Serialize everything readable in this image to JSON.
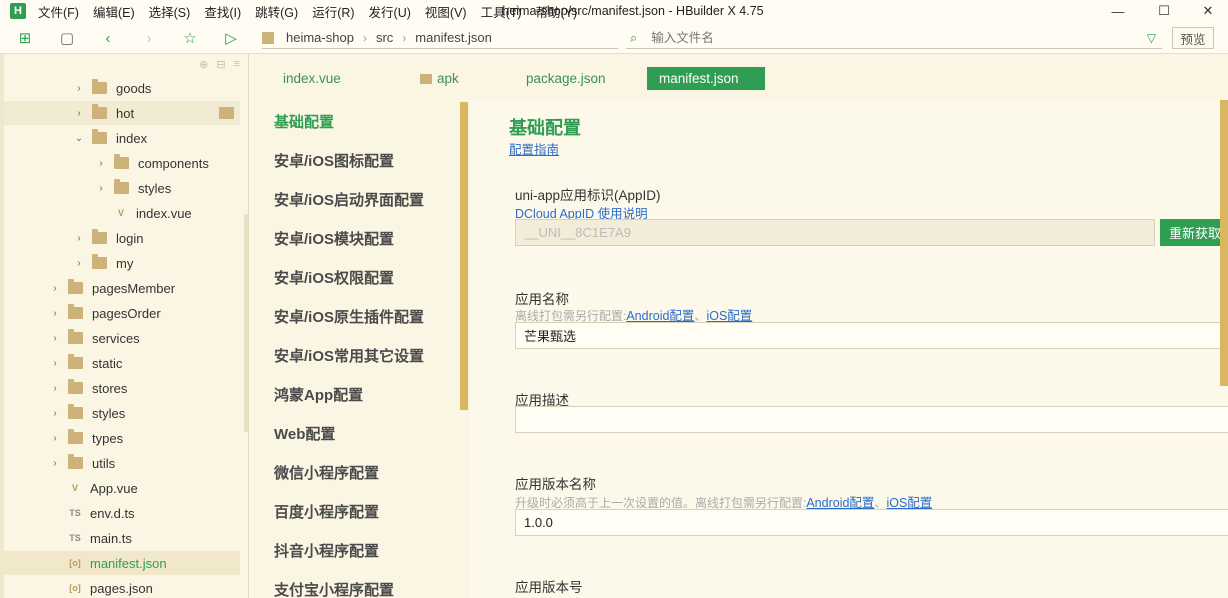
{
  "menubar": {
    "logo": "H",
    "items": [
      "文件(F)",
      "编辑(E)",
      "选择(S)",
      "查找(I)",
      "跳转(G)",
      "运行(R)",
      "发行(U)",
      "视图(V)",
      "工具(T)",
      "帮助(Y)"
    ],
    "title": "heima-shop/src/manifest.json - HBuilder X 4.75"
  },
  "toolbar": {
    "breadcrumb": [
      "heima-shop",
      "src",
      "manifest.json"
    ],
    "search_placeholder": "输入文件名",
    "preview_label": "预览"
  },
  "tree": [
    {
      "label": "goods",
      "type": "folder",
      "depth": 3,
      "expanded": false
    },
    {
      "label": "hot",
      "type": "folder",
      "depth": 3,
      "expanded": false
    },
    {
      "label": "index",
      "type": "folder",
      "depth": 3,
      "expanded": true
    },
    {
      "label": "components",
      "type": "folder",
      "depth": 4,
      "expanded": false
    },
    {
      "label": "styles",
      "type": "folder",
      "depth": 4,
      "expanded": false
    },
    {
      "label": "index.vue",
      "type": "vue",
      "depth": 4
    },
    {
      "label": "login",
      "type": "folder",
      "depth": 3,
      "expanded": false
    },
    {
      "label": "my",
      "type": "folder",
      "depth": 3,
      "expanded": false
    },
    {
      "label": "pagesMember",
      "type": "folder",
      "depth": 2,
      "expanded": false
    },
    {
      "label": "pagesOrder",
      "type": "folder",
      "depth": 2,
      "expanded": false
    },
    {
      "label": "services",
      "type": "folder",
      "depth": 2,
      "expanded": false
    },
    {
      "label": "static",
      "type": "folder",
      "depth": 2,
      "expanded": false
    },
    {
      "label": "stores",
      "type": "folder",
      "depth": 2,
      "expanded": false
    },
    {
      "label": "styles",
      "type": "folder",
      "depth": 2,
      "expanded": false
    },
    {
      "label": "types",
      "type": "folder",
      "depth": 2,
      "expanded": false
    },
    {
      "label": "utils",
      "type": "folder",
      "depth": 2,
      "expanded": false
    },
    {
      "label": "App.vue",
      "type": "vue",
      "depth": 2
    },
    {
      "label": "env.d.ts",
      "type": "ts",
      "depth": 2
    },
    {
      "label": "main.ts",
      "type": "ts",
      "depth": 2
    },
    {
      "label": "manifest.json",
      "type": "json",
      "depth": 2,
      "selected": true
    },
    {
      "label": "pages.json",
      "type": "json",
      "depth": 2
    }
  ],
  "tabs": [
    {
      "label": "index.vue",
      "icon": "none"
    },
    {
      "label": "apk",
      "icon": "folder"
    },
    {
      "label": "package.json",
      "icon": "none"
    },
    {
      "label": "manifest.json",
      "icon": "none",
      "active": true
    }
  ],
  "config_nav": [
    "基础配置",
    "安卓/iOS图标配置",
    "安卓/iOS启动界面配置",
    "安卓/iOS模块配置",
    "安卓/iOS权限配置",
    "安卓/iOS原生插件配置",
    "安卓/iOS常用其它设置",
    "鸿蒙App配置",
    "Web配置",
    "微信小程序配置",
    "百度小程序配置",
    "抖音小程序配置",
    "支付宝小程序配置"
  ],
  "content": {
    "title": "基础配置",
    "guide_link": "配置指南",
    "appid": {
      "label": "uni-app应用标识(AppID)",
      "link": "DCloud AppID 使用说明",
      "value": "__UNI__8C1E7A9",
      "button": "重新获取"
    },
    "app_name": {
      "label": "应用名称",
      "hint": "离线打包需另行配置:",
      "link_android": "Android配置",
      "link_ios": "iOS配置",
      "value": "芒果甄选"
    },
    "app_desc": {
      "label": "应用描述",
      "value": ""
    },
    "version_name": {
      "label": "应用版本名称",
      "hint": "升级时必须高于上一次设置的值。离线打包需另行配置:",
      "link_android": "Android配置",
      "link_ios": "iOS配置",
      "value": "1.0.0"
    },
    "version_code": {
      "label": "应用版本号"
    }
  },
  "colors": {
    "accent": "#2f9e52",
    "background": "#fbf6e4",
    "link": "#2a6cc9",
    "scrollbar": "#d9b65f"
  }
}
